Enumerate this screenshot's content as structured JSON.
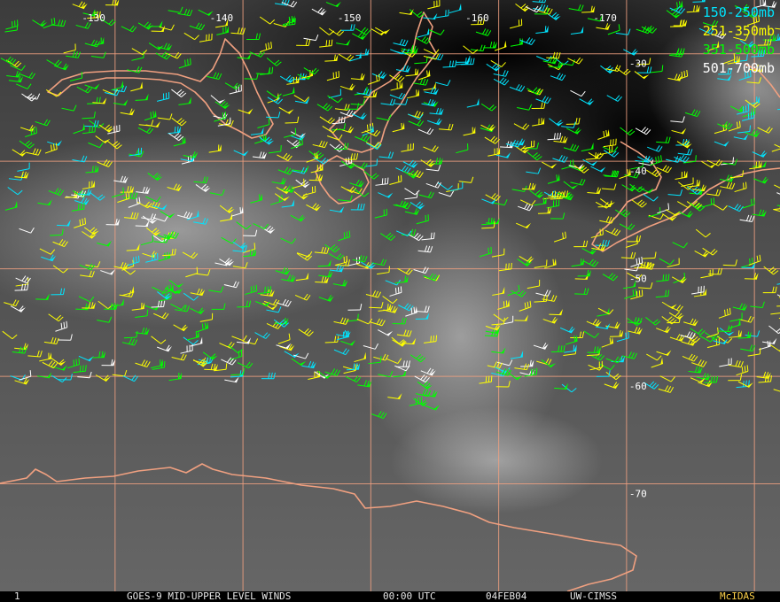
{
  "map": {
    "lon_labels": [
      {
        "lon": -130,
        "text": "-130"
      },
      {
        "lon": -140,
        "text": "-140"
      },
      {
        "lon": -150,
        "text": "-150"
      },
      {
        "lon": -160,
        "text": "-160"
      },
      {
        "lon": -170,
        "text": "-170"
      }
    ],
    "lat_labels": [
      {
        "lat": -30,
        "text": "-30"
      },
      {
        "lat": -40,
        "text": "-40"
      },
      {
        "lat": -50,
        "text": "-50"
      },
      {
        "lat": -60,
        "text": "-60"
      },
      {
        "lat": -70,
        "text": "-70"
      }
    ],
    "grid_color": "#f0a080",
    "coast_color": "#f0a080",
    "lon_range": [
      -121,
      -182
    ],
    "lat_range": [
      -25,
      -80
    ]
  },
  "legend": [
    {
      "label": "150-250mb",
      "color": "#00e5ff"
    },
    {
      "label": "251-350mb",
      "color": "#ffff00"
    },
    {
      "label": "351-500mb",
      "color": "#00ff00"
    },
    {
      "label": "501-700mb",
      "color": "#ffffff"
    }
  ],
  "status": {
    "frame": "1",
    "satellite_product": "GOES-9 MID-UPPER LEVEL WINDS",
    "time": "00:00 UTC",
    "date": "04FEB04",
    "source": "UW-CIMSS",
    "software": "McIDAS",
    "software_color": "#ffd24a"
  }
}
